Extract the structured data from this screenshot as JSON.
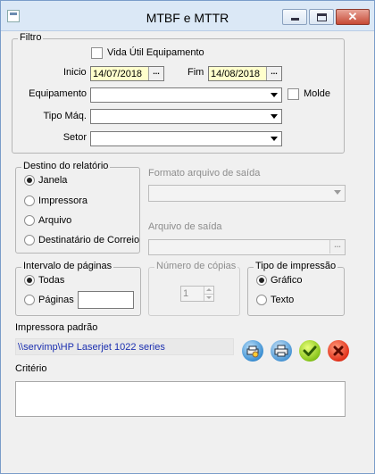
{
  "window": {
    "title": "MTBF e MTTR"
  },
  "filtro": {
    "legend": "Filtro",
    "vida_util_label": "Vida Útil Equipamento",
    "inicio_label": "Inicio",
    "inicio_value": "14/07/2018",
    "fim_label": "Fim",
    "fim_value": "14/08/2018",
    "date_button_label": "...",
    "equipamento_label": "Equipamento",
    "equipamento_value": "",
    "molde_label": "Molde",
    "tipo_maq_label": "Tipo Máq.",
    "tipo_maq_value": "",
    "setor_label": "Setor",
    "setor_value": ""
  },
  "destino": {
    "legend": "Destino do relatório",
    "options": [
      {
        "label": "Janela",
        "selected": true
      },
      {
        "label": "Impressora",
        "selected": false
      },
      {
        "label": "Arquivo",
        "selected": false
      },
      {
        "label": "Destinatário de Correio",
        "selected": false
      }
    ]
  },
  "formato": {
    "label": "Formato arquivo de saída",
    "value": ""
  },
  "arquivo": {
    "label": "Arquivo de saída",
    "value": "",
    "button_label": "..."
  },
  "intervalo": {
    "legend": "Intervalo de páginas",
    "todas_label": "Todas",
    "paginas_label": "Páginas",
    "paginas_value": "",
    "selected": "Todas"
  },
  "copias": {
    "legend": "Número de cópias",
    "value": "1"
  },
  "tipo_impressao": {
    "legend": "Tipo de impressão",
    "grafico_label": "Gráfico",
    "texto_label": "Texto",
    "selected": "Gráfico"
  },
  "impressora": {
    "label": "Impressora padrão",
    "value": "\\\\servimp\\HP Laserjet 1022 series"
  },
  "criterio": {
    "label": "Critério",
    "value": ""
  },
  "icons": {
    "app": "form-icon",
    "printer_setup": "printer-setup-icon",
    "print": "printer-icon",
    "ok": "check-icon",
    "cancel": "x-icon"
  },
  "colors": {
    "date_field_bg": "#ffffcc",
    "printer_text": "#1b2fb0"
  }
}
